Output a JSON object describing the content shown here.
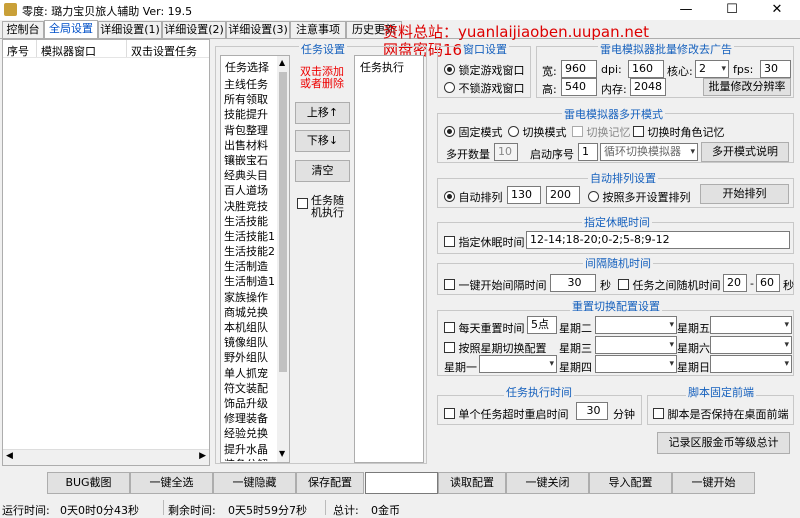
{
  "window": {
    "title": "零度: 璐力宝贝旅人辅助 Ver:  19.5",
    "min": "—",
    "max": "☐",
    "close": "✕"
  },
  "watermark": {
    "line1": "资料总站：yuanlaijiaoben.uupan.net",
    "line2": "网盘密码16888"
  },
  "tabs": [
    "控制台",
    "全局设置",
    "详细设置(1)",
    "详细设置(2)",
    "详细设置(3)",
    "注意事项",
    "历史更新"
  ],
  "left_table": {
    "headers": [
      "序号",
      "模拟器窗口",
      "双击设置任务"
    ]
  },
  "task_panel": {
    "header": "任务设置",
    "hint": "双击添加\n或者删除",
    "list_header": "任务选择",
    "tasks": [
      "主线任务",
      "所有领取",
      "技能提升",
      "背包整理",
      "出售材料",
      "镶嵌宝石",
      "经典头目",
      "百人道场",
      "决胜竞技",
      "生活技能",
      "生活技能1",
      "生活技能2",
      "生活制造",
      "生活制造1",
      "家族操作",
      "商城兑换",
      "本机组队",
      "镜像组队",
      "野外组队",
      "单人抓宠",
      "符文装配",
      "饰品升级",
      "修理装备",
      "经验兑换",
      "提升水晶",
      "装备分解"
    ],
    "move_up": "上移↑",
    "move_down": "下移↓",
    "clear": "清空",
    "random_check": "任务随\n机执行",
    "exec_header": "任务执行"
  },
  "window_settings": {
    "header": "窗口设置",
    "lock": "锁定游戏窗口",
    "unlock": "不锁游戏窗口"
  },
  "batch": {
    "header": "雷电模拟器批量修改去广告",
    "width_label": "宽:",
    "width": "960",
    "dpi_label": "dpi:",
    "dpi": "160",
    "core_label": "核心:",
    "core": "2",
    "fps_label": "fps:",
    "fps": "30",
    "height_label": "高:",
    "height": "540",
    "mem_label": "内存:",
    "mem": "2048",
    "btn": "批量修改分辨率"
  },
  "multi": {
    "header": "雷电模拟器多开模式",
    "fixed": "固定模式",
    "switch": "切换模式",
    "switch_remember": "切换记忆",
    "switch_role_remember": "切换时角色记忆",
    "count_label": "多开数量",
    "count": "10",
    "start_label": "启动序号",
    "start": "1",
    "loop": "循环切换模拟器",
    "explain_btn": "多开模式说明"
  },
  "arrange": {
    "header": "自动排列设置",
    "auto": "自动排列",
    "w": "130",
    "h": "200",
    "by_multi": "按照多开设置排列",
    "btn": "开始排列"
  },
  "sleep": {
    "header": "指定休眠时间",
    "check": "指定休眠时间",
    "value": "12-14;18-20;0-2;5-8;9-12"
  },
  "interval": {
    "header": "间隔随机时间",
    "check1": "一键开始间隔时间",
    "sec": "30",
    "sec_label": "秒",
    "check2": "任务之间随机时间",
    "min": "20",
    "dash": "-",
    "max": "60",
    "sec2": "秒"
  },
  "reset": {
    "header": "重置切换配置设置",
    "daily": "每天重置时间",
    "daily_val": "5点",
    "by_week": "按照星期切换配置",
    "days": [
      "星期一",
      "星期二",
      "星期三",
      "星期四",
      "星期五",
      "星期六",
      "星期日"
    ]
  },
  "timing": {
    "header": "任务执行时间",
    "check": "单个任务超时重启时间",
    "val": "30",
    "unit": "分钟"
  },
  "script": {
    "header": "脚本固定前端",
    "check": "脚本是否保持在桌面前端"
  },
  "record_btn": "记录区服金币等级总计",
  "bottom": [
    "BUG截图",
    "一键全选",
    "一键隐藏",
    "保存配置",
    "",
    "读取配置",
    "一键关闭",
    "导入配置",
    "一键开始"
  ],
  "status": {
    "run_label": "运行时间:",
    "run": "0天0时0分43秒",
    "left_label": "剩余时间:",
    "left": "0天5时59分7秒",
    "total_label": "总计:",
    "total": "0金币"
  }
}
